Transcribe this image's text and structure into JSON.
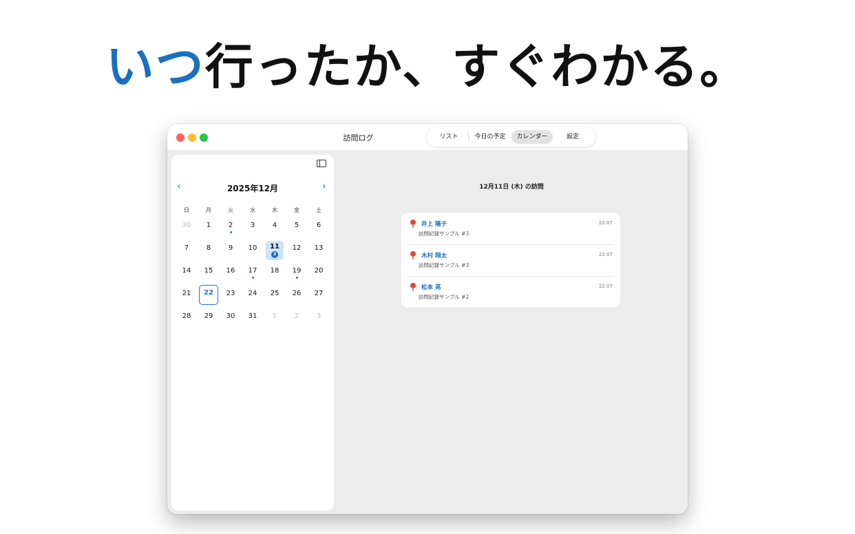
{
  "headline": {
    "accent": "いつ",
    "rest": "行ったか、すぐわかる。"
  },
  "window": {
    "title": "訪問ログ",
    "tabs": [
      {
        "label": "リスト",
        "active": false
      },
      {
        "label": "今日の予定",
        "active": false
      },
      {
        "label": "カレンダー",
        "active": true
      },
      {
        "label": "設定",
        "active": false
      }
    ]
  },
  "calendar": {
    "month_label": "2025年12月",
    "prev_icon": "chevron-left-icon",
    "next_icon": "chevron-right-icon",
    "weekdays": [
      "日",
      "月",
      "火",
      "水",
      "木",
      "金",
      "土"
    ],
    "weeks": [
      [
        {
          "label": "30",
          "muted": true
        },
        {
          "label": "1"
        },
        {
          "label": "2",
          "dot": true
        },
        {
          "label": "3"
        },
        {
          "label": "4"
        },
        {
          "label": "5"
        },
        {
          "label": "6"
        }
      ],
      [
        {
          "label": "7"
        },
        {
          "label": "8"
        },
        {
          "label": "9"
        },
        {
          "label": "10"
        },
        {
          "label": "11",
          "selected": true,
          "badge": "3"
        },
        {
          "label": "12"
        },
        {
          "label": "13"
        }
      ],
      [
        {
          "label": "14"
        },
        {
          "label": "15"
        },
        {
          "label": "16"
        },
        {
          "label": "17",
          "dot": true
        },
        {
          "label": "18"
        },
        {
          "label": "19",
          "dot": true
        },
        {
          "label": "20"
        }
      ],
      [
        {
          "label": "21"
        },
        {
          "label": "22",
          "today": true
        },
        {
          "label": "23"
        },
        {
          "label": "24"
        },
        {
          "label": "25"
        },
        {
          "label": "26"
        },
        {
          "label": "27"
        }
      ],
      [
        {
          "label": "28"
        },
        {
          "label": "29"
        },
        {
          "label": "30"
        },
        {
          "label": "31"
        },
        {
          "label": "1",
          "muted": true
        },
        {
          "label": "2",
          "muted": true
        },
        {
          "label": "3",
          "muted": true
        }
      ]
    ]
  },
  "main": {
    "title": "12月11日 (木) の訪問",
    "visits": [
      {
        "name": "井上 陽子",
        "time": "22:07",
        "note": "訪問記録サンプル #3"
      },
      {
        "name": "木村 翔太",
        "time": "22:07",
        "note": "訪問記録サンプル #3"
      },
      {
        "name": "松本 亮",
        "time": "22:07",
        "note": "訪問記録サンプル #2"
      }
    ]
  },
  "colors": {
    "accent": "#1a6fc0",
    "link": "#1a73d9",
    "selected_bg": "#cfe3f8",
    "pin": "#e0483e"
  }
}
